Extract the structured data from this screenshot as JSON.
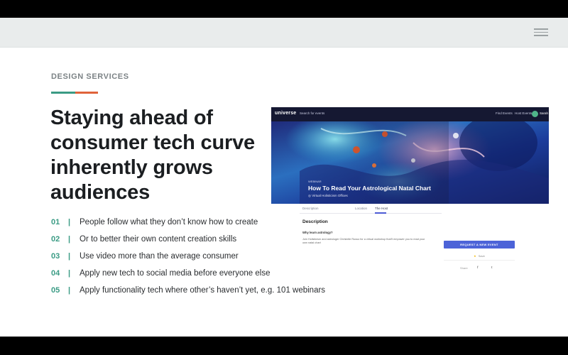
{
  "slide": {
    "eyebrow": "DESIGN SERVICES",
    "accent_colors": [
      "#3a9b84",
      "#e0633a"
    ],
    "headline": "Staying ahead of consumer tech curve inherently grows audiences",
    "points": [
      {
        "num": "01",
        "sep": "|",
        "text": "People follow what they don’t know how to create"
      },
      {
        "num": "02",
        "sep": "|",
        "text": "Or to better their own content creation skills"
      },
      {
        "num": "03",
        "sep": "|",
        "text": "Use video more than the average consumer"
      },
      {
        "num": "04",
        "sep": "|",
        "text": "Apply new tech to social media before everyone else"
      },
      {
        "num": "05",
        "sep": "|",
        "text": "Apply functionality tech where other’s haven’t yet, e.g. 101 webinars"
      }
    ],
    "number_color": "#3a9b84"
  },
  "topbar": {
    "menu_icon": "hamburger-menu-icon"
  },
  "screenshot": {
    "nav": {
      "logo": "universe",
      "search": "Search for events",
      "link1": "Find Events",
      "link2": "Host Events",
      "user": "Sarah"
    },
    "hero": {
      "eyebrow": "WEBINAR",
      "title": "How To Read Your Astrological Natal Chart",
      "location": "Virtual Holisticism Offices"
    },
    "tabs": [
      {
        "label": "Description"
      },
      {
        "label": "Location"
      },
      {
        "label": "The Host"
      }
    ],
    "description": {
      "heading": "Description",
      "question": "Why learn astrology?",
      "text": "Join Holisticism and astrologer Christelle Russo for a virtual workshop that'll empower you to read your own natal chart"
    },
    "side": {
      "button": "REQUEST A NEW EVENT",
      "save": "Save",
      "share": "Share",
      "social1": "f",
      "social2": "t"
    }
  }
}
